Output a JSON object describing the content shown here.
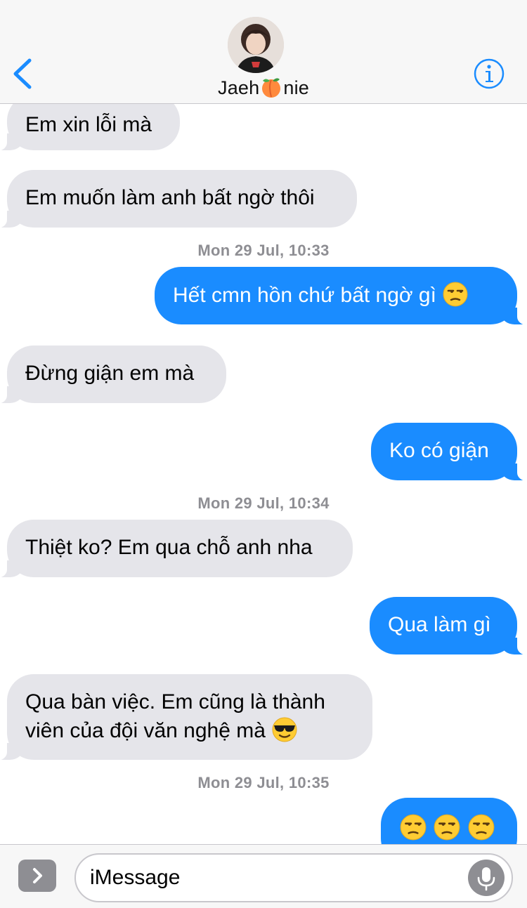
{
  "header": {
    "contact_name_prefix": "Jaeh",
    "contact_name_suffix": "nie",
    "contact_name_emoji": "peach-icon"
  },
  "messages": [
    {
      "direction": "incoming",
      "text": "Em xin lỗi mà"
    },
    {
      "direction": "incoming",
      "text": "Em muốn làm anh bất ngờ thôi"
    },
    {
      "timestamp": "Mon 29 Jul, 10:33"
    },
    {
      "direction": "outgoing",
      "text": "Hết cmn hồn chứ bất ngờ gì",
      "emoji": "unamused-face"
    },
    {
      "direction": "incoming",
      "text": "Đừng giận em mà"
    },
    {
      "direction": "outgoing",
      "text": "Ko có giận"
    },
    {
      "timestamp": "Mon 29 Jul, 10:34"
    },
    {
      "direction": "incoming",
      "text": "Thiệt ko? Em qua chỗ anh nha"
    },
    {
      "direction": "outgoing",
      "text": "Qua làm gì"
    },
    {
      "direction": "incoming",
      "lines": [
        "Qua bàn việc. Em cũng là thành",
        "viên của đội văn nghệ mà"
      ],
      "emoji": "smiling-face-with-sunglasses"
    },
    {
      "timestamp": "Mon 29 Jul, 10:35"
    },
    {
      "direction": "outgoing",
      "emoji": "unamused-face",
      "emoji_count": 3
    }
  ],
  "input": {
    "placeholder": "iMessage"
  },
  "colors": {
    "outgoing_bubble": "#1a8cff",
    "incoming_bubble": "#e5e5ea",
    "accent": "#1a8cff",
    "timestamp": "#8e8e93"
  }
}
